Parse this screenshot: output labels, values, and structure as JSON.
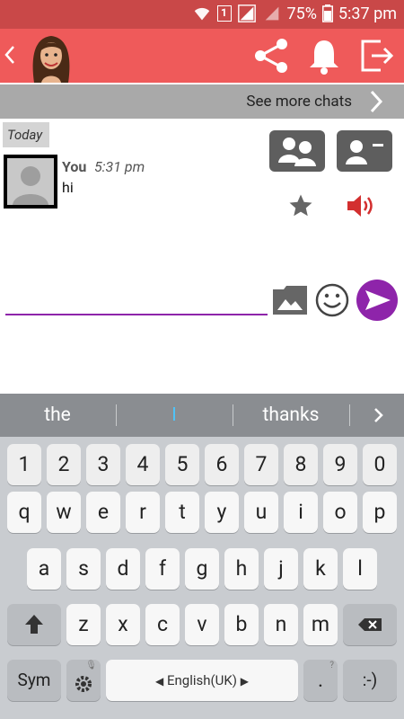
{
  "status_bar": {
    "battery": "75%",
    "time": "5:37 pm",
    "sim_badge": "1"
  },
  "app_bar": {
    "back_icon": "chevron-left-icon",
    "actions": [
      "share-icon",
      "bell-icon",
      "exit-icon"
    ]
  },
  "see_more": {
    "label": "See more chats"
  },
  "chat": {
    "date_label": "Today",
    "messages": [
      {
        "sender": "You",
        "time": "5:31 pm",
        "text": "hi"
      }
    ]
  },
  "composer": {
    "value": "",
    "placeholder": ""
  },
  "suggestions": {
    "left": "the",
    "middle": "I",
    "right": "thanks"
  },
  "keyboard": {
    "row_numbers": [
      "1",
      "2",
      "3",
      "4",
      "5",
      "6",
      "7",
      "8",
      "9",
      "0"
    ],
    "row_1": [
      "q",
      "w",
      "e",
      "r",
      "t",
      "y",
      "u",
      "i",
      "o",
      "p"
    ],
    "row_2": [
      "a",
      "s",
      "d",
      "f",
      "g",
      "h",
      "j",
      "k",
      "l"
    ],
    "row_3": [
      "z",
      "x",
      "c",
      "v",
      "b",
      "n",
      "m"
    ],
    "sym_label": "Sym",
    "language_label": "English(UK)",
    "period_label": ".",
    "period_hint": "?",
    "smiley_label": ":-)"
  },
  "colors": {
    "status_bar": "#c94848",
    "app_bar": "#ef5a5a",
    "accent_purple": "#8e24aa",
    "speaker_red": "#d32f2f"
  }
}
